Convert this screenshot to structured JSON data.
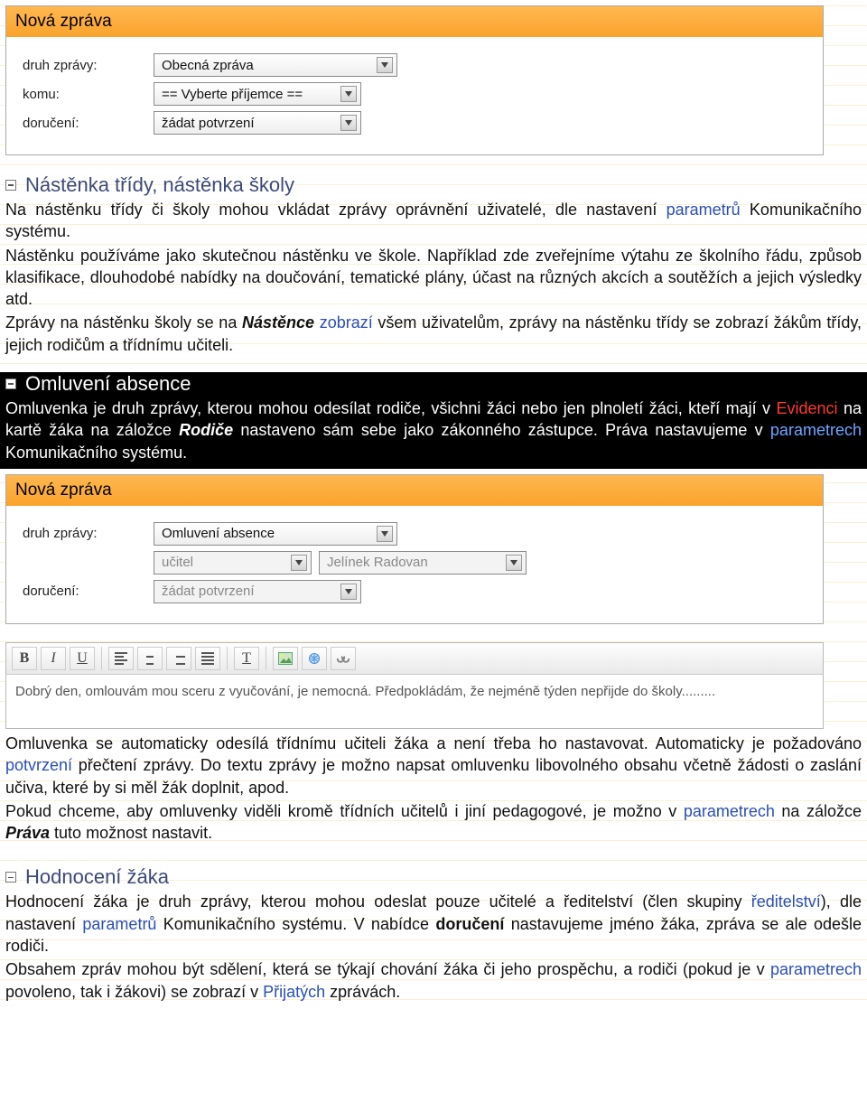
{
  "panel1": {
    "title": "Nová zpráva",
    "rows": {
      "druh_label": "druh zprávy:",
      "druh_value": "Obecná zpráva",
      "komu_label": "komu:",
      "komu_value": "== Vyberte příjemce ==",
      "doruceni_label": "doručení:",
      "doruceni_value": "žádat potvrzení"
    }
  },
  "sect_nastenka": {
    "title": "Nástěnka třídy, nástěnka školy",
    "p1_a": "Na nástěnku třídy či školy mohou vkládat zprávy oprávnění uživatelé, dle nastavení ",
    "p1_link": "parametrů",
    "p1_b": " Komunikačního systému.",
    "p2": "Nástěnku používáme jako skutečnou nástěnku ve škole. Například zde zveřejníme výtahu ze školního řádu, způsob klasifikace, dlouhodobé nabídky na doučování, tematické plány, účast na různých akcích a soutěžích a jejich výsledky  atd.",
    "p3_a": "Zprávy na nástěnku školy se na ",
    "p3_em": "Nástěnce",
    "p3_b": " ",
    "p3_link": "zobrazí",
    "p3_c": " všem uživatelům, zprávy na nástěnku třídy se zobrazí žákům třídy, jejich rodičům a třídnímu učiteli."
  },
  "sect_omluveni": {
    "title": "Omluvení absence",
    "p1_a": "Omluvenka je druh zprávy, kterou mohou odesílat rodiče, všichni žáci nebo jen plnoletí žáci, kteří mají v ",
    "p1_ev": "Evidenci",
    "p1_b": " na kartě žáka na záložce ",
    "p1_rod": "Rodiče",
    "p1_c": " nastaveno sám sebe jako zákonného zástupce. Práva nastavujeme v ",
    "p1_link": "parametrech",
    "p1_d": " Komunikačního systému."
  },
  "panel2": {
    "title": "Nová zpráva",
    "rows": {
      "druh_label": "druh zprávy:",
      "druh_value": "Omluvení absence",
      "ucitel_value": "učitel",
      "jmeno_value": "Jelínek Radovan",
      "doruceni_label": "doručení:",
      "doruceni_value": "žádat potvrzení"
    },
    "editor_text": "Dobrý den, omlouvám mou sceru z vyučování, je nemocná. Předpokládám, že nejméně týden nepřijde do školy........."
  },
  "after_editor": {
    "p1_a": "Omluvenka se automaticky odesílá třídnímu učiteli žáka a není třeba ho nastavovat. Automaticky je požadováno ",
    "p1_link": "potvrzení",
    "p1_b": " přečtení zprávy. Do textu zprávy je možno napsat omluvenku libovolného obsahu včetně žádosti o zaslání učiva, které by si měl žák doplnit, apod.",
    "p2_a": "Pokud chceme, aby omluvenky viděli kromě třídních učitelů i jiní pedagogové, je možno v ",
    "p2_link": "parametrech",
    "p2_b": " na záložce ",
    "p2_em": "Práva",
    "p2_c": " tuto možnost nastavit."
  },
  "sect_hodnoceni": {
    "title": "Hodnocení žáka",
    "p1_a": "Hodnocení žáka je druh zprávy, kterou mohou odeslat pouze učitelé a ředitelství (člen skupiny ",
    "p1_link1": "ředitelství",
    "p1_b": "), dle nastavení ",
    "p1_link2": "parametrů",
    "p1_c": " Komunikačního systému. V nabídce ",
    "p1_bold": "doručení",
    "p1_d": " nastavujeme jméno žáka, zpráva se ale odešle rodiči.",
    "p2_a": "Obsahem zpráv mohou být sdělení, která se týkají chování žáka či jeho prospěchu, a rodiči (pokud je v ",
    "p2_link1": "parametrech",
    "p2_b": " povoleno, tak i žákovi) se zobrazí v ",
    "p2_link2": "Přijatých",
    "p2_c": " zprávách."
  }
}
